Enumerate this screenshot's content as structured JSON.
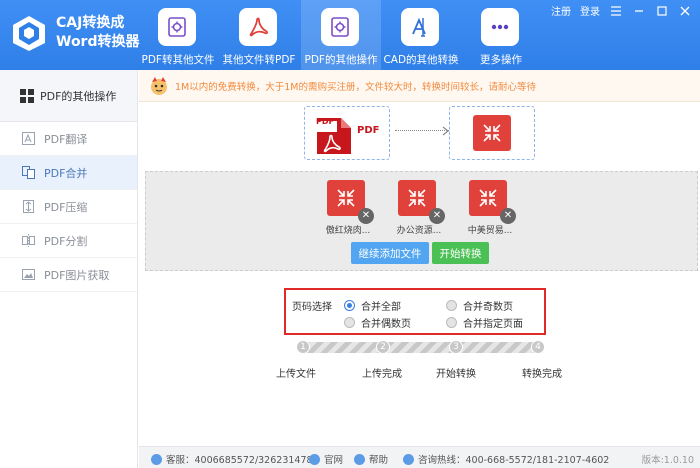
{
  "app": {
    "title_line1": "CAJ转换成",
    "title_line2": "Word转换器"
  },
  "nav": [
    {
      "label": "PDF转其他文件",
      "icon": "pdf-gear-icon"
    },
    {
      "label": "其他文件转PDF",
      "icon": "acrobat-icon"
    },
    {
      "label": "PDF的其他操作",
      "icon": "pdf-gear-icon"
    },
    {
      "label": "CAD的其他转换",
      "icon": "cad-icon"
    },
    {
      "label": "更多操作",
      "icon": "more-dots-icon"
    }
  ],
  "top_links": {
    "register": "注册",
    "login": "登录"
  },
  "sidebar": {
    "header": "PDF的其他操作",
    "items": [
      {
        "label": "PDF翻译",
        "icon": "translate-icon"
      },
      {
        "label": "PDF合并",
        "icon": "merge-icon"
      },
      {
        "label": "PDF压缩",
        "icon": "compress-icon"
      },
      {
        "label": "PDF分割",
        "icon": "split-icon"
      },
      {
        "label": "PDF图片获取",
        "icon": "image-extract-icon"
      }
    ]
  },
  "notice": "1M以内的免费转换，大于1M的需购买注册，文件较大时，转换时间较长，请耐心等待",
  "flow": {
    "pdf_text": "PDF",
    "pdf_badge": "PDF"
  },
  "files": [
    {
      "name": "傲红烧肉..."
    },
    {
      "name": "办公资源..."
    },
    {
      "name": "中美贸易..."
    }
  ],
  "buttons": {
    "add_more": "继续添加文件",
    "start": "开始转换"
  },
  "page_options": {
    "label": "页码选择",
    "options": [
      "合并全部",
      "合并奇数页",
      "合并偶数页",
      "合并指定页面"
    ],
    "selected": "合并全部"
  },
  "steps": [
    {
      "num": "1",
      "label": "上传文件"
    },
    {
      "num": "2",
      "label": "上传完成"
    },
    {
      "num": "3",
      "label": "开始转换"
    },
    {
      "num": "4",
      "label": "转换完成"
    }
  ],
  "footer": {
    "service": "客服：4006685572/326231478",
    "site": "官网",
    "help": "帮助",
    "hotline": "咨询热线：400-668-5572/181-2107-4602",
    "version": "版本:1.0.10"
  },
  "colors": {
    "header_blue": "#2f7fe8",
    "accent_red": "#e0413a",
    "selection_border": "#e02a2a",
    "start_green": "#4bc155",
    "add_blue": "#52a5f0"
  }
}
